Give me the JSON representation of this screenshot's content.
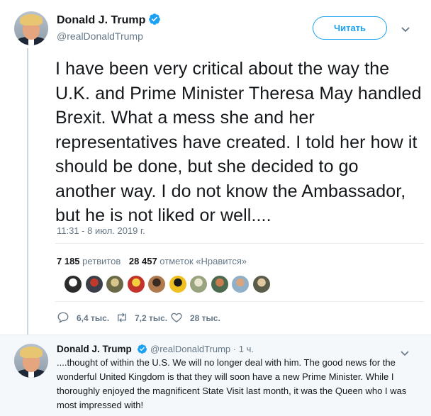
{
  "tweet": {
    "author_name": "Donald J. Trump",
    "author_handle": "@realDonaldTrump",
    "follow_label": "Читать",
    "text": "I have been very critical about the way the U.K. and Prime Minister Theresa May handled Brexit. What a mess she and her representatives have created. I told her how it should be done, but she decided to go another way. I do not know the Ambassador, but he is not liked or well....",
    "timestamp": "11:31 - 8 июл. 2019 г.",
    "retweets_count": "7 185",
    "retweets_label": "ретвитов",
    "likes_count": "28 457",
    "likes_label": "отметок «Нравится»",
    "replies_short": "6,4 тыс.",
    "retweets_short": "7,2 тыс.",
    "likes_short": "28 тыс."
  },
  "reply": {
    "author_name": "Donald J. Trump",
    "author_handle": "@realDonaldTrump",
    "time_ago": "· 1 ч.",
    "text": "....thought of within the U.S. We will no longer deal with him. The good news for the wonderful United Kingdom is that they will soon have a new Prime Minister. While I thoroughly enjoyed the magnificent State Visit last month, it was the Queen who I was most impressed with!"
  },
  "likers": [
    {
      "icon": "liker-avatar-q",
      "color": "#2b2b2b",
      "accent": "#ffffff"
    },
    {
      "icon": "liker-avatar-2",
      "color": "#3a3f4a",
      "accent": "#c0392b"
    },
    {
      "icon": "liker-avatar-3",
      "color": "#6b6a48",
      "accent": "#d7c58a"
    },
    {
      "icon": "liker-avatar-4",
      "color": "#c2332b",
      "accent": "#f4d03f"
    },
    {
      "icon": "liker-avatar-5",
      "color": "#b07a4e",
      "accent": "#3b2a20"
    },
    {
      "icon": "liker-avatar-6",
      "color": "#f0c020",
      "accent": "#1a1a1a"
    },
    {
      "icon": "liker-avatar-7",
      "color": "#9aa37f",
      "accent": "#e9e6d0"
    },
    {
      "icon": "liker-avatar-8",
      "color": "#4c6a4f",
      "accent": "#c97d4f"
    },
    {
      "icon": "liker-avatar-9",
      "color": "#8fb0c8",
      "accent": "#d8a47e"
    },
    {
      "icon": "liker-avatar-10",
      "color": "#5c5c4a",
      "accent": "#e0c8a0"
    }
  ],
  "colors": {
    "accent": "#1da1f2",
    "text": "#14171a",
    "secondary": "#657786"
  }
}
